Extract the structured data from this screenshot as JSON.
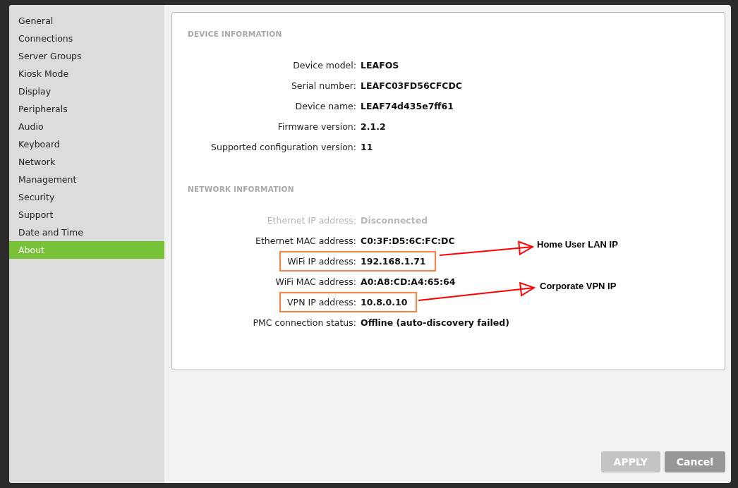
{
  "sidebar": {
    "items": [
      {
        "label": "General",
        "selected": false
      },
      {
        "label": "Connections",
        "selected": false
      },
      {
        "label": "Server Groups",
        "selected": false
      },
      {
        "label": "Kiosk Mode",
        "selected": false
      },
      {
        "label": "Display",
        "selected": false
      },
      {
        "label": "Peripherals",
        "selected": false
      },
      {
        "label": "Audio",
        "selected": false
      },
      {
        "label": "Keyboard",
        "selected": false
      },
      {
        "label": "Network",
        "selected": false
      },
      {
        "label": "Management",
        "selected": false
      },
      {
        "label": "Security",
        "selected": false
      },
      {
        "label": "Support",
        "selected": false
      },
      {
        "label": "Date and Time",
        "selected": false
      },
      {
        "label": "About",
        "selected": true
      }
    ]
  },
  "sections": [
    {
      "title": "DEVICE INFORMATION",
      "rows": [
        {
          "label": "Device model:",
          "value": "LEAFOS",
          "disabled": false,
          "highlighted": false
        },
        {
          "label": "Serial number:",
          "value": "LEAFC03FD56CFCDC",
          "disabled": false,
          "highlighted": false
        },
        {
          "label": "Device name:",
          "value": "LEAF74d435e7ff61",
          "disabled": false,
          "highlighted": false
        },
        {
          "label": "Firmware version:",
          "value": "2.1.2",
          "disabled": false,
          "highlighted": false
        },
        {
          "label": "Supported configuration version:",
          "value": "11",
          "disabled": false,
          "highlighted": false
        }
      ]
    },
    {
      "title": "NETWORK INFORMATION",
      "rows": [
        {
          "label": "Ethernet IP address:",
          "value": "Disconnected",
          "disabled": true,
          "highlighted": false
        },
        {
          "label": "Ethernet MAC address:",
          "value": "C0:3F:D5:6C:FC:DC",
          "disabled": false,
          "highlighted": false
        },
        {
          "label": "WiFi IP address:",
          "value": "192.168.1.71",
          "disabled": false,
          "highlighted": true
        },
        {
          "label": "WiFi MAC address:",
          "value": "A0:A8:CD:A4:65:64",
          "disabled": false,
          "highlighted": false
        },
        {
          "label": "VPN IP address:",
          "value": "10.8.0.10",
          "disabled": false,
          "highlighted": true
        },
        {
          "label": "PMC connection status:",
          "value": "Offline (auto-discovery failed)",
          "disabled": false,
          "highlighted": false
        }
      ]
    }
  ],
  "annotations": [
    {
      "text": "Home User LAN IP"
    },
    {
      "text": "Corporate VPN IP"
    }
  ],
  "buttons": [
    {
      "label": "APPLY",
      "disabled": true
    },
    {
      "label": "Cancel",
      "disabled": false
    }
  ]
}
